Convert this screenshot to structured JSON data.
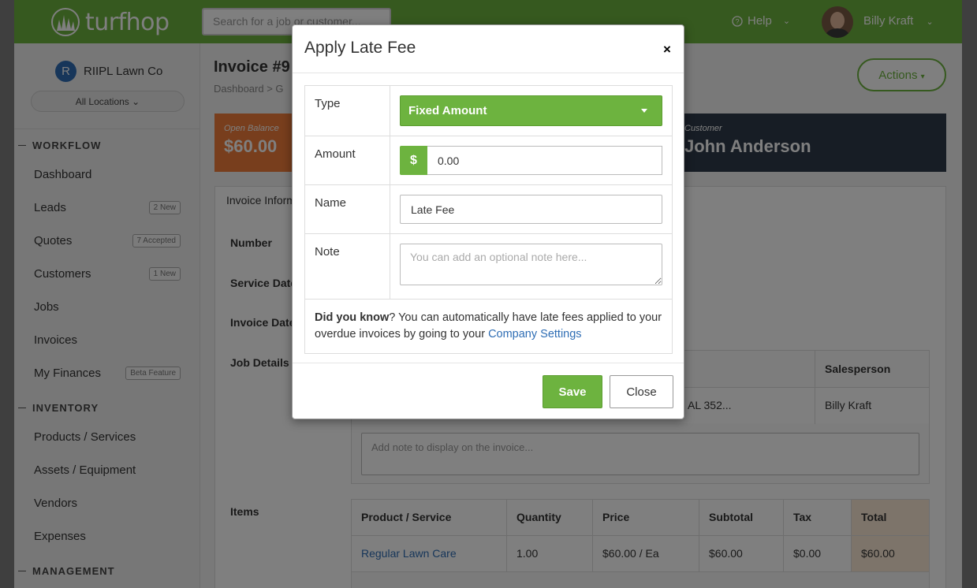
{
  "topbar": {
    "logo_text": "turfhop",
    "search_placeholder": "Search for a job or customer...",
    "help_label": "Help",
    "user_name": "Billy Kraft"
  },
  "sidebar": {
    "company_initial": "R",
    "company_name": "RIIPL Lawn Co",
    "locations_label": "All Locations",
    "sections": {
      "workflow": "WORKFLOW",
      "inventory": "INVENTORY",
      "management": "MANAGEMENT"
    },
    "items": {
      "dashboard": "Dashboard",
      "leads": "Leads",
      "leads_badge": "2 New",
      "quotes": "Quotes",
      "quotes_badge": "7 Accepted",
      "customers": "Customers",
      "customers_badge": "1 New",
      "jobs": "Jobs",
      "invoices": "Invoices",
      "finances": "My Finances",
      "finances_badge": "Beta Feature",
      "products": "Products / Services",
      "assets": "Assets / Equipment",
      "vendors": "Vendors",
      "expenses": "Expenses"
    }
  },
  "main": {
    "title": "Invoice #9",
    "breadcrumb": "Dashboard  >  G",
    "actions_label": "Actions",
    "open_balance_label": "Open Balance",
    "open_balance_value": "$60.00",
    "customer_label": "Customer",
    "customer_value": "John Anderson",
    "tab_label": "Invoice Inform",
    "fields": {
      "number": "Number",
      "service_date": "Service Date",
      "invoice_date": "Invoice Date",
      "job_details": "Job Details",
      "items": "Items"
    },
    "job_table": {
      "salesperson_header": "Salesperson",
      "address_fragment": "AL 352...",
      "salesperson_value": "Billy Kraft",
      "note_placeholder": "Add note to display on the invoice..."
    },
    "items_table": {
      "headers": [
        "Product / Service",
        "Quantity",
        "Price",
        "Subtotal",
        "Tax",
        "Total"
      ],
      "rows": [
        [
          "Regular Lawn Care",
          "1.00",
          "$60.00 / Ea",
          "$60.00",
          "$0.00",
          "$60.00"
        ]
      ]
    }
  },
  "modal": {
    "title": "Apply Late Fee",
    "close_x": "×",
    "type_label": "Type",
    "type_value": "Fixed Amount",
    "amount_label": "Amount",
    "amount_addon": "$",
    "amount_value": "0.00",
    "name_label": "Name",
    "name_value": "Late Fee",
    "note_label": "Note",
    "note_placeholder": "You can add an optional note here...",
    "tip_bold": "Did you know",
    "tip_text": "? You can automatically have late fees applied to your overdue invoices by going to your ",
    "tip_link": "Company Settings",
    "save_label": "Save",
    "close_label": "Close"
  },
  "colors": {
    "brand_green": "#6db33f",
    "balance_orange": "#f07d3a",
    "customer_navy": "#2f3b4a",
    "link_blue": "#2e6db4"
  }
}
